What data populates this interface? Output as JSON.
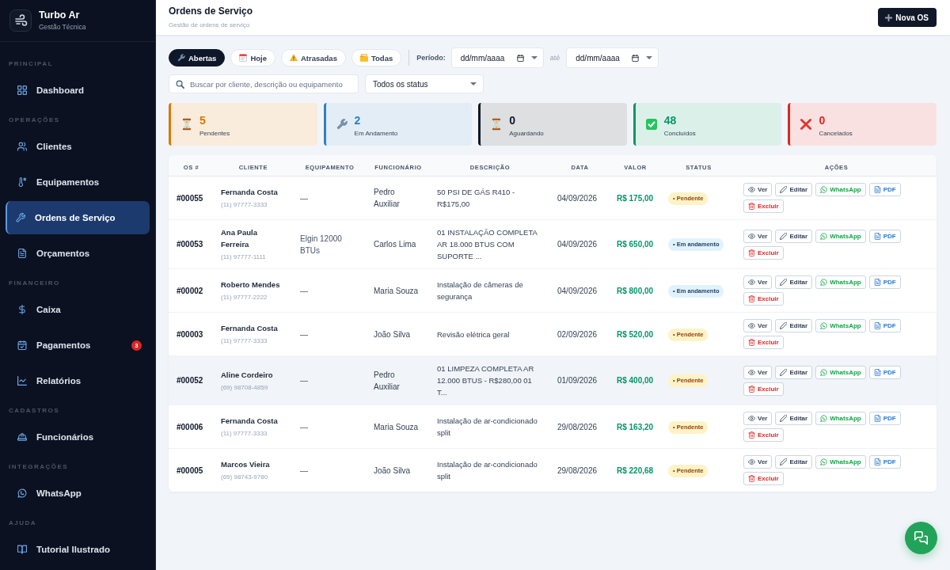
{
  "sidebar": {
    "brand": {
      "name": "Turbo Ar",
      "tagline": "Gestão Técnica"
    },
    "sections": [
      {
        "title": "PRINCIPAL",
        "items": [
          {
            "label": "Dashboard",
            "selected": false
          }
        ]
      },
      {
        "title": "OPERAÇÕES",
        "items": [
          {
            "label": "Clientes",
            "selected": false
          },
          {
            "label": "Equipamentos",
            "selected": false
          },
          {
            "label": "Ordens de Serviço",
            "selected": true
          },
          {
            "label": "Orçamentos",
            "selected": false
          }
        ]
      },
      {
        "title": "FINANCEIRO",
        "items": [
          {
            "label": "Caixa",
            "selected": false
          },
          {
            "label": "Pagamentos",
            "selected": false,
            "badge": "3"
          },
          {
            "label": "Relatórios",
            "selected": false
          }
        ]
      },
      {
        "title": "CADASTROS",
        "items": [
          {
            "label": "Funcionários",
            "selected": false
          }
        ]
      },
      {
        "title": "INTEGRAÇÕES",
        "items": [
          {
            "label": "WhatsApp",
            "selected": false
          }
        ]
      },
      {
        "title": "AJUDA",
        "items": [
          {
            "label": "Tutorial Ilustrado",
            "selected": false
          }
        ]
      }
    ]
  },
  "header": {
    "title": "Ordens de Serviço",
    "subtitle": "Gestão de ordens de serviço",
    "button": "Nova OS"
  },
  "filters": {
    "tabs": [
      {
        "label": "Abertas",
        "selected": true
      },
      {
        "label": "Hoje",
        "selected": false
      },
      {
        "label": "Atrasadas",
        "selected": false
      },
      {
        "label": "Todas",
        "selected": false
      }
    ],
    "period_label": "Período:",
    "date_from": {
      "placeholder": "dd/mm/aaaa"
    },
    "separator": "até",
    "date_to": {
      "placeholder": "dd/mm/aaaa"
    },
    "search": {
      "placeholder": "Buscar por cliente, descrição ou equipamento"
    },
    "status_select": {
      "value": "Todos os status"
    }
  },
  "stats": [
    {
      "value": "5",
      "label": "Pendentes",
      "color": "#d97706"
    },
    {
      "value": "2",
      "label": "Em Andamento",
      "color": "#2f80c0"
    },
    {
      "value": "0",
      "label": "Aguardando",
      "color": "#0f172a"
    },
    {
      "value": "48",
      "label": "Concluídos",
      "color": "#059669"
    },
    {
      "value": "0",
      "label": "Cancelados",
      "color": "#dc2626"
    }
  ],
  "table": {
    "columns": [
      "OS #",
      "CLIENTE",
      "EQUIPAMENTO",
      "FUNCIONÁRIO",
      "DESCRIÇÃO",
      "DATA",
      "VALOR",
      "STATUS",
      "AÇÕES"
    ],
    "rows": [
      {
        "os": "#00055",
        "client": "Fernanda Costa",
        "phone": "(11) 97777-3333",
        "equipment": "—",
        "employee": "Pedro Auxiliar",
        "description": "50 PSI DE GÁS R410 - R$175,00",
        "date": "04/09/2026",
        "value": "R$ 175,00",
        "status": {
          "label": "• Pendente",
          "kind": "pending"
        },
        "hovered": false,
        "actions": [
          {
            "label": "Ver",
            "kind": "view"
          },
          {
            "label": "Editar",
            "kind": "edit"
          },
          {
            "label": "WhatsApp",
            "kind": "whatsapp"
          },
          {
            "label": "PDF",
            "kind": "pdf"
          },
          {
            "label": "Excluir",
            "kind": "delete"
          }
        ]
      },
      {
        "os": "#00053",
        "client": "Ana Paula Ferreira",
        "phone": "(11) 97777-1111",
        "equipment": "Elgin 12000 BTUs",
        "employee": "Carlos Lima",
        "description": "01 INSTALAÇÃO COMPLETA AR 18.000 BTUS COM SUPORTE ...",
        "date": "04/09/2026",
        "value": "R$ 650,00",
        "status": {
          "label": "• Em andamento",
          "kind": "progress"
        },
        "hovered": false,
        "actions": [
          {
            "label": "Ver",
            "kind": "view"
          },
          {
            "label": "Editar",
            "kind": "edit"
          },
          {
            "label": "WhatsApp",
            "kind": "whatsapp"
          },
          {
            "label": "PDF",
            "kind": "pdf"
          },
          {
            "label": "Excluir",
            "kind": "delete"
          }
        ]
      },
      {
        "os": "#00002",
        "client": "Roberto Mendes",
        "phone": "(11) 97777-2222",
        "equipment": "—",
        "employee": "Maria Souza",
        "description": "Instalação de câmeras de segurança",
        "date": "04/09/2026",
        "value": "R$ 800,00",
        "status": {
          "label": "• Em andamento",
          "kind": "progress"
        },
        "hovered": false,
        "actions": [
          {
            "label": "Ver",
            "kind": "view"
          },
          {
            "label": "Editar",
            "kind": "edit"
          },
          {
            "label": "WhatsApp",
            "kind": "whatsapp"
          },
          {
            "label": "PDF",
            "kind": "pdf"
          },
          {
            "label": "Excluir",
            "kind": "delete"
          }
        ]
      },
      {
        "os": "#00003",
        "client": "Fernanda Costa",
        "phone": "(11) 97777-3333",
        "equipment": "—",
        "employee": "João Silva",
        "description": "Revisão elétrica geral",
        "date": "02/09/2026",
        "value": "R$ 520,00",
        "status": {
          "label": "• Pendente",
          "kind": "pending"
        },
        "hovered": false,
        "actions": [
          {
            "label": "Ver",
            "kind": "view"
          },
          {
            "label": "Editar",
            "kind": "edit"
          },
          {
            "label": "WhatsApp",
            "kind": "whatsapp"
          },
          {
            "label": "PDF",
            "kind": "pdf"
          },
          {
            "label": "Excluir",
            "kind": "delete"
          }
        ]
      },
      {
        "os": "#00052",
        "client": "Aline Cordeiro",
        "phone": "(69) 98708-4859",
        "equipment": "—",
        "employee": "Pedro Auxiliar",
        "description": "01 LIMPEZA COMPLETA AR 12.000 BTUS - R$280,00 01 T...",
        "date": "01/09/2026",
        "value": "R$ 400,00",
        "status": {
          "label": "• Pendente",
          "kind": "pending"
        },
        "hovered": true,
        "actions": [
          {
            "label": "Ver",
            "kind": "view"
          },
          {
            "label": "Editar",
            "kind": "edit"
          },
          {
            "label": "WhatsApp",
            "kind": "whatsapp"
          },
          {
            "label": "PDF",
            "kind": "pdf"
          },
          {
            "label": "Excluir",
            "kind": "delete"
          }
        ]
      },
      {
        "os": "#00006",
        "client": "Fernanda Costa",
        "phone": "(11) 97777-3333",
        "equipment": "—",
        "employee": "Maria Souza",
        "description": "Instalação de ar-condicionado split",
        "date": "29/08/2026",
        "value": "R$ 163,20",
        "status": {
          "label": "• Pendente",
          "kind": "pending"
        },
        "hovered": false,
        "actions": [
          {
            "label": "Ver",
            "kind": "view"
          },
          {
            "label": "Editar",
            "kind": "edit"
          },
          {
            "label": "WhatsApp",
            "kind": "whatsapp"
          },
          {
            "label": "PDF",
            "kind": "pdf"
          },
          {
            "label": "Excluir",
            "kind": "delete"
          }
        ]
      },
      {
        "os": "#00005",
        "client": "Marcos Vieira",
        "phone": "(69) 98743-9780",
        "equipment": "—",
        "employee": "João Silva",
        "description": "Instalação de ar-condicionado split",
        "date": "29/08/2026",
        "value": "R$ 220,68",
        "status": {
          "label": "• Pendente",
          "kind": "pending"
        },
        "hovered": false,
        "actions": [
          {
            "label": "Ver",
            "kind": "view"
          },
          {
            "label": "Editar",
            "kind": "edit"
          },
          {
            "label": "WhatsApp",
            "kind": "whatsapp"
          },
          {
            "label": "PDF",
            "kind": "pdf"
          },
          {
            "label": "Excluir",
            "kind": "delete"
          }
        ]
      }
    ]
  }
}
